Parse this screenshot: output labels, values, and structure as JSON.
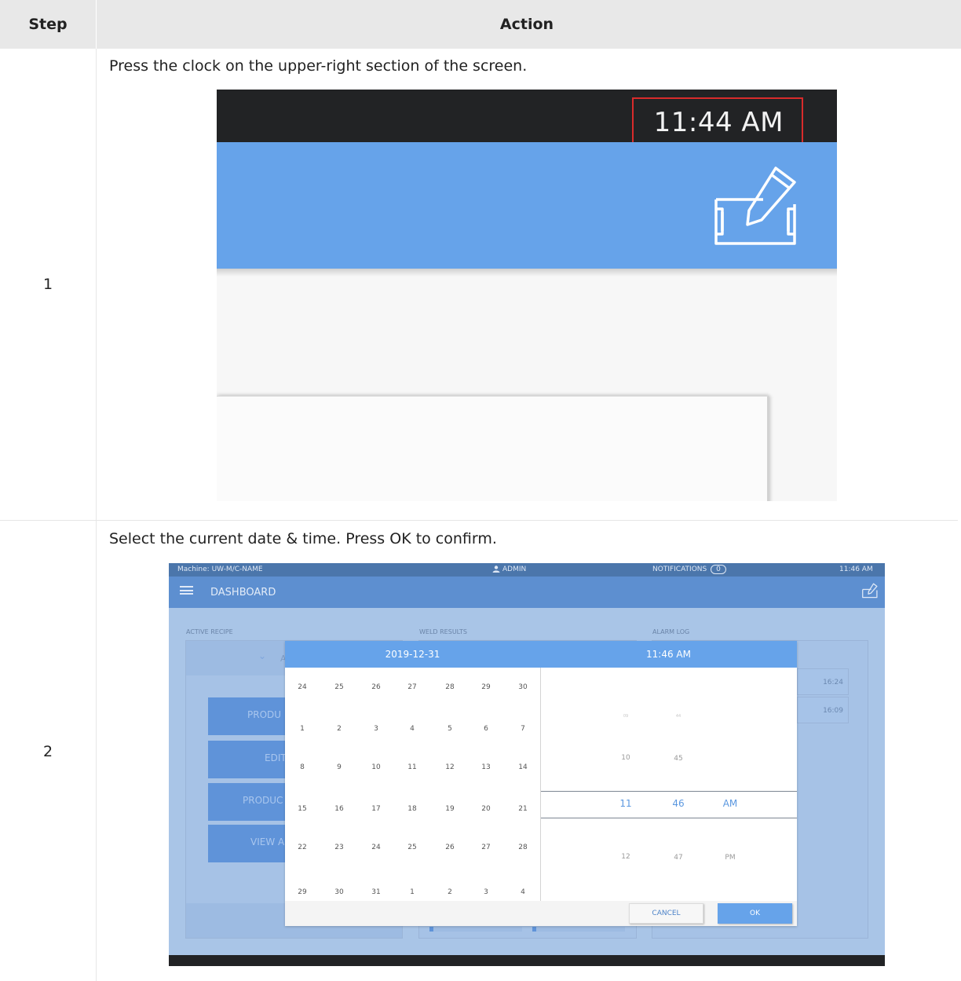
{
  "table": {
    "header_step": "Step",
    "header_action": "Action",
    "rows": [
      {
        "step": "1",
        "instruction": "Press the clock on the upper-right section of the screen.",
        "screen": {
          "clock": "11:44 AM",
          "icon": "edit-tablet-icon",
          "highlight_color": "#d92b2b"
        }
      },
      {
        "step": "2",
        "instruction": "Select the current date & time. Press OK to confirm.",
        "screen": {
          "top_bar": {
            "machine": "Machine: UW-M/C-NAME",
            "user": "ADMIN",
            "notifications": "NOTIFICATIONS",
            "notifications_count": "0",
            "clock": "11:46 AM"
          },
          "nav_title": "DASHBOARD",
          "columns": [
            "ACTIVE RECIPE",
            "WELD RESULTS",
            "ALARM LOG"
          ],
          "recipe_label_partial": "A",
          "buttons": [
            "PRODU",
            "EDIT",
            "PRODUC",
            "VIEW A"
          ],
          "alarm_times": [
            "16:24",
            "16:09"
          ],
          "dialog": {
            "date": "2019-12-31",
            "time": "11:46 AM",
            "calendar": [
              [
                "24",
                "25",
                "26",
                "27",
                "28",
                "29",
                "30"
              ],
              [
                "1",
                "2",
                "3",
                "4",
                "5",
                "6",
                "7"
              ],
              [
                "8",
                "9",
                "10",
                "11",
                "12",
                "13",
                "14"
              ],
              [
                "15",
                "16",
                "17",
                "18",
                "19",
                "20",
                "21"
              ],
              [
                "22",
                "23",
                "24",
                "25",
                "26",
                "27",
                "28"
              ],
              [
                "29",
                "30",
                "31",
                "1",
                "2",
                "3",
                "4"
              ]
            ],
            "picker": {
              "faint": {
                "hour": "09",
                "minute": "44"
              },
              "above": {
                "hour": "10",
                "minute": "45"
              },
              "selected": {
                "hour": "11",
                "minute": "46",
                "period": "AM"
              },
              "below": {
                "hour": "12",
                "minute": "47",
                "period": "PM"
              }
            },
            "cancel_label": "CANCEL",
            "ok_label": "OK"
          },
          "colors": {
            "accent": "#66a3ea",
            "nav": "#5d8fd0",
            "top_bar": "#4b76ab",
            "dark_bar": "#222325"
          }
        }
      }
    ]
  }
}
